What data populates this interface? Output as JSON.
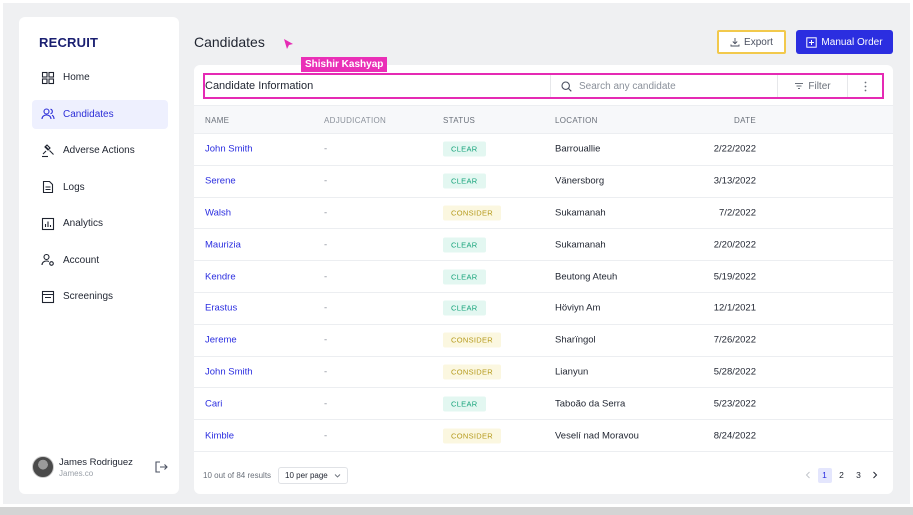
{
  "brand": "RECRUIT",
  "sidebar": {
    "items": [
      {
        "label": "Home",
        "icon": "grid-icon"
      },
      {
        "label": "Candidates",
        "icon": "users-icon"
      },
      {
        "label": "Adverse Actions",
        "icon": "gavel-icon"
      },
      {
        "label": "Logs",
        "icon": "document-icon"
      },
      {
        "label": "Analytics",
        "icon": "bar-chart-icon"
      },
      {
        "label": "Account",
        "icon": "user-gear-icon"
      },
      {
        "label": "Screenings",
        "icon": "screen-icon"
      }
    ],
    "active": "Candidates"
  },
  "user": {
    "name": "James Rodriguez",
    "sub": "James.co"
  },
  "header": {
    "title": "Candidates",
    "export_label": "Export",
    "manual_order_label": "Manual Order"
  },
  "annotation_tag": "Shishir Kashyap",
  "toolbar": {
    "title": "Candidate Information",
    "search_placeholder": "Search any candidate",
    "filter_label": "Filter"
  },
  "table": {
    "columns": [
      "NAME",
      "ADJUDICATION",
      "STATUS",
      "LOCATION",
      "DATE"
    ],
    "rows": [
      {
        "name": "John Smith",
        "adjudication": "-",
        "status": "CLEAR",
        "location": "Barrouallie",
        "date": "2/22/2022"
      },
      {
        "name": "Serene",
        "adjudication": "-",
        "status": "CLEAR",
        "location": "Vänersborg",
        "date": "3/13/2022"
      },
      {
        "name": "Walsh",
        "adjudication": "-",
        "status": "CONSIDER",
        "location": "Sukamanah",
        "date": "7/2/2022"
      },
      {
        "name": "Maurizia",
        "adjudication": "-",
        "status": "CLEAR",
        "location": "Sukamanah",
        "date": "2/20/2022"
      },
      {
        "name": "Kendre",
        "adjudication": "-",
        "status": "CLEAR",
        "location": "Beutong Ateuh",
        "date": "5/19/2022"
      },
      {
        "name": "Erastus",
        "adjudication": "-",
        "status": "CLEAR",
        "location": "Höviyn Am",
        "date": "12/1/2021"
      },
      {
        "name": "Jereme",
        "adjudication": "-",
        "status": "CONSIDER",
        "location": "Sharïngol",
        "date": "7/26/2022"
      },
      {
        "name": "John Smith",
        "adjudication": "-",
        "status": "CONSIDER",
        "location": "Lianyun",
        "date": "5/28/2022"
      },
      {
        "name": "Cari",
        "adjudication": "-",
        "status": "CLEAR",
        "location": "Taboão da Serra",
        "date": "5/23/2022"
      },
      {
        "name": "Kimble",
        "adjudication": "-",
        "status": "CONSIDER",
        "location": "Veselí nad Moravou",
        "date": "8/24/2022"
      }
    ]
  },
  "footer": {
    "results": "10 out of 84 results",
    "per_page": "10 per page",
    "pages": [
      "1",
      "2",
      "3"
    ],
    "current_page": "1"
  },
  "colors": {
    "accent": "#2b2ee0",
    "brand": "#1a1f71",
    "clear": "#16a37a",
    "consider": "#b59a1b",
    "highlight_pink": "#e52ab4",
    "highlight_yellow": "#f2c94c"
  }
}
